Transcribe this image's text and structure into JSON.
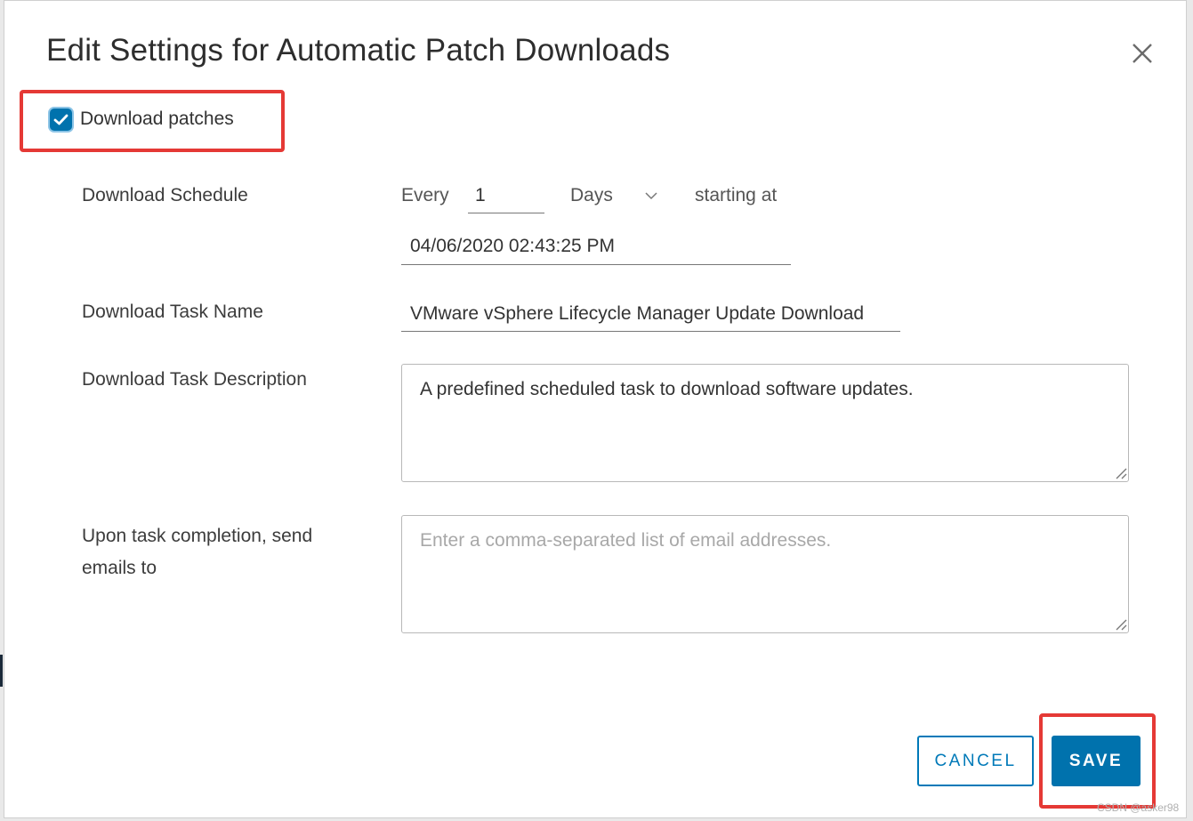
{
  "dialog": {
    "title": "Edit Settings for Automatic Patch Downloads",
    "close_icon": "close-icon"
  },
  "download_patches": {
    "label": "Download patches",
    "checked": true
  },
  "schedule": {
    "label": "Download Schedule",
    "every_label": "Every",
    "every_value": "1",
    "unit_selected": "Days",
    "starting_at_label": "starting at",
    "start_datetime": "04/06/2020 02:43:25 PM"
  },
  "task_name": {
    "label": "Download Task Name",
    "value": "VMware vSphere Lifecycle Manager Update Download"
  },
  "task_description": {
    "label": "Download Task Description",
    "value": "A predefined scheduled task to download software updates."
  },
  "email": {
    "label": "Upon task completion, send emails to",
    "placeholder": "Enter a comma-separated list of email addresses.",
    "value": ""
  },
  "buttons": {
    "cancel_label": "CANCEL",
    "save_label": "SAVE"
  },
  "watermark": "CSDN @asker98",
  "colors": {
    "accent": "#0072ad",
    "highlight": "#e53935"
  }
}
